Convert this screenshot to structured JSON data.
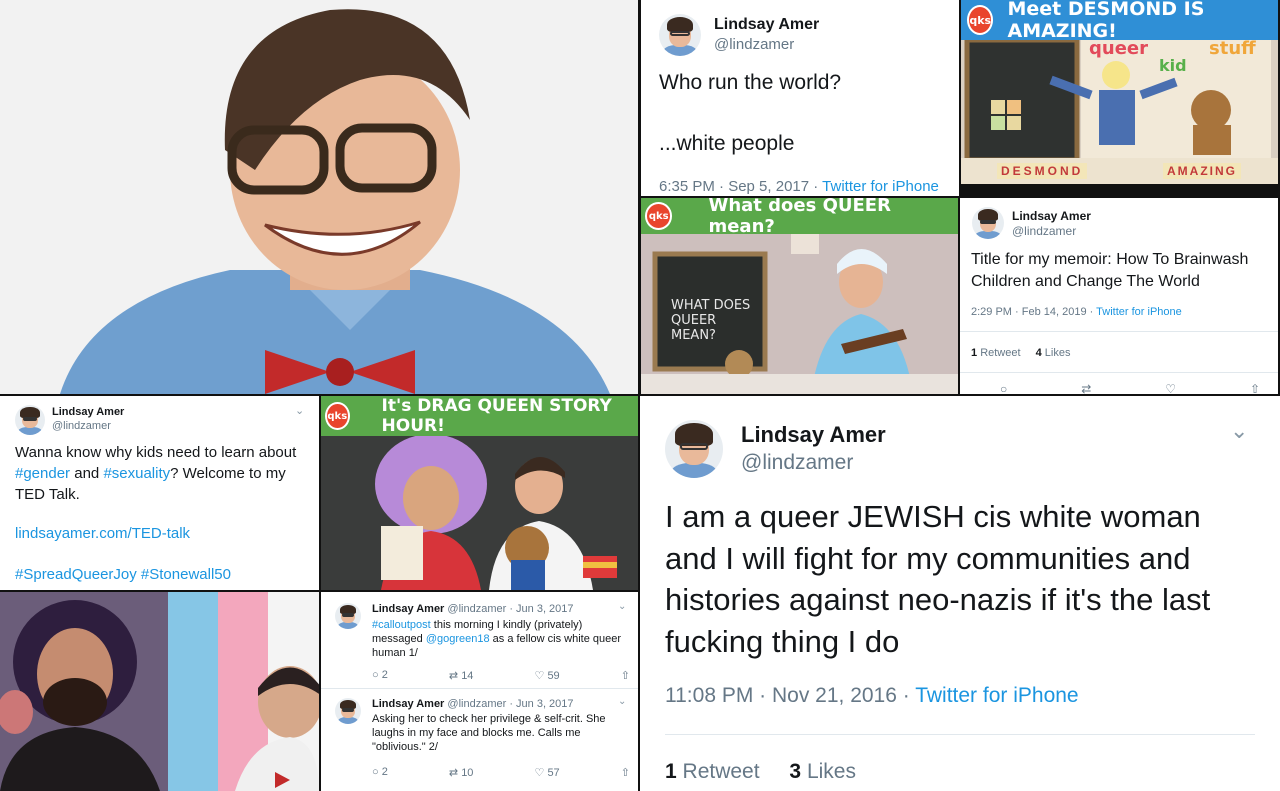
{
  "tweet_sep5": {
    "name": "Lindsay Amer",
    "handle": "@lindzamer",
    "line1": "Who run the world?",
    "line2": "...white people",
    "time": "6:35 PM · Sep 5, 2017 · ",
    "source": "Twitter for iPhone"
  },
  "thumb_desmond": {
    "logo": "qks",
    "title": "Meet DESMOND IS AMAZING!",
    "word_queer": "queer",
    "word_kid": "kid",
    "word_stuff": "stuff",
    "blocks": "DESMOND",
    "blocks2": "AMAZING"
  },
  "thumb_queer": {
    "logo": "qks",
    "title": "What does QUEER mean?",
    "chalk": "WHAT DOES QUEER MEAN?"
  },
  "tweet_memoir": {
    "name": "Lindsay Amer",
    "handle": "@lindzamer",
    "text": "Title for my memoir: How To Brainwash Children and Change The World",
    "time": "2:29 PM · Feb 14, 2019 · ",
    "source": "Twitter for iPhone",
    "retweets_num": "1",
    "retweets_label": "Retweet",
    "likes_num": "4",
    "likes_label": "Likes"
  },
  "tweet_ted": {
    "name": "Lindsay Amer",
    "handle": "@lindzamer",
    "text_a": "Wanna know why kids need to learn about ",
    "tag_gender": "#gender",
    "text_b": " and ",
    "tag_sexuality": "#sexuality",
    "text_c": "? Welcome to my TED Talk.",
    "url": "lindsayamer.com/TED-talk",
    "tags": "#SpreadQueerJoy #Stonewall50"
  },
  "thumb_drag": {
    "logo": "qks",
    "title": "It's DRAG QUEEN STORY HOUR!"
  },
  "tweet_callout1": {
    "name": "Lindsay Amer",
    "handle_date": "@lindzamer · Jun 3, 2017",
    "tag": "#calloutpost",
    "text_a": " this morning I kindly (privately) messaged ",
    "mention": "@gogreen18",
    "text_b": " as a fellow cis white queer human 1/",
    "replies": "2",
    "retweets": "14",
    "likes": "59"
  },
  "tweet_callout2": {
    "name": "Lindsay Amer",
    "handle_date": "@lindzamer · Jun 3, 2017",
    "text": "Asking her to check her privilege & self-crit. She laughs in my face and blocks me. Calls me \"oblivious.\" 2/",
    "replies": "2",
    "retweets": "10",
    "likes": "57"
  },
  "tweet_jewish": {
    "name": "Lindsay Amer",
    "handle": "@lindzamer",
    "text": "I am a queer JEWISH cis white woman and I will fight for my communities and histories against neo-nazis if it's the last fucking thing I do",
    "time": "11:08 PM · Nov 21, 2016 · ",
    "source": "Twitter for iPhone",
    "retweets_num": "1",
    "retweets_label": "Retweet",
    "likes_num": "3",
    "likes_label": "Likes"
  },
  "colors": {
    "twitter_blue": "#1b95e0",
    "banner_blue": "#2f8fd6",
    "banner_green": "#5aa84a",
    "logo_red": "#e9452d"
  }
}
